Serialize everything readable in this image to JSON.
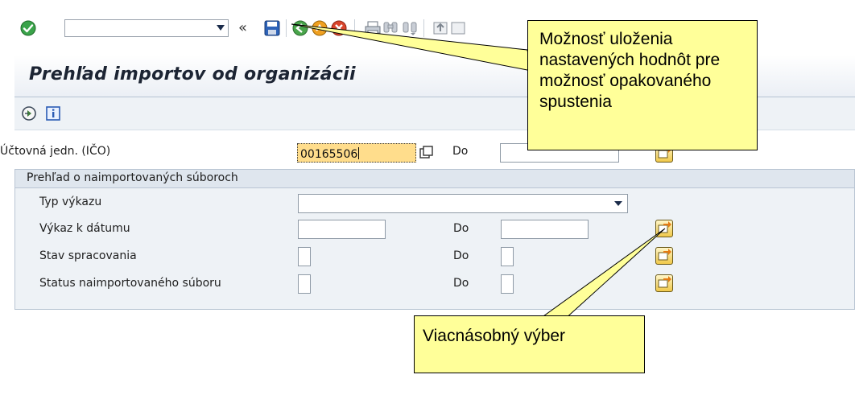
{
  "toolbar": {
    "command_field_value": "",
    "back_glyph": "«"
  },
  "page": {
    "title": "Prehľad importov od organizácii"
  },
  "fields": {
    "uctovna_label": "Účtovná jedn. (IČO)",
    "uctovna_value": "00165506",
    "do_label": "Do"
  },
  "group": {
    "title": "Prehľad o naimportovaných súboroch",
    "rows": [
      {
        "label": "Typ výkazu"
      },
      {
        "label": "Výkaz k dátumu",
        "to_label": "Do"
      },
      {
        "label": "Stav spracovania",
        "to_label": "Do"
      },
      {
        "label": "Status naimportovaného súboru",
        "to_label": "Do"
      }
    ]
  },
  "callouts": {
    "save_variant": "Možnosť uloženia nastavených hodnôt pre možnosť opakovaného spustenia",
    "multiple_selection": "Viacnásobný výber"
  },
  "colors": {
    "active_field": "#ffdd8c",
    "callout_bg": "#ffff99",
    "group_bg": "#eef2f6"
  }
}
